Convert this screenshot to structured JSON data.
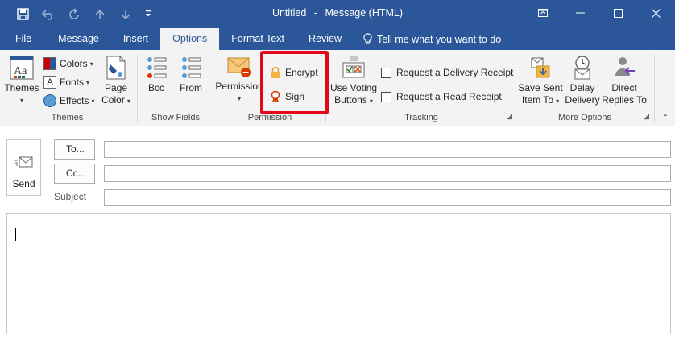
{
  "window": {
    "title_doc": "Untitled",
    "title_sep": "-",
    "title_type": "Message (HTML)",
    "titlebar_color": "#2b579a"
  },
  "quick_access": {
    "save_icon": "save-icon",
    "undo_icon": "undo-icon",
    "redo_icon": "redo-icon",
    "up_icon": "up-arrow-icon",
    "down_icon": "down-arrow-icon",
    "customize_icon": "customize-qat-icon"
  },
  "tabs": [
    {
      "label": "File"
    },
    {
      "label": "Message"
    },
    {
      "label": "Insert"
    },
    {
      "label": "Options",
      "active": true
    },
    {
      "label": "Format Text"
    },
    {
      "label": "Review"
    }
  ],
  "tellme": "Tell me what you want to do",
  "ribbon": {
    "themes_group": {
      "themes_label": "Themes",
      "colors_label": "Colors",
      "fonts_label": "Fonts",
      "effects_label": "Effects",
      "page_label_1": "Page",
      "page_label_2": "Color",
      "group_label": "Themes"
    },
    "show_fields": {
      "bcc_label": "Bcc",
      "from_label": "From",
      "group_label": "Show Fields"
    },
    "permission": {
      "permission_label": "Permission",
      "encrypt_label": "Encrypt",
      "sign_label": "Sign",
      "group_label": "Permission",
      "highlight_color": "#e3071a"
    },
    "tracking": {
      "voting_1": "Use Voting",
      "voting_2": "Buttons",
      "delivery_receipt": "Request a Delivery Receipt",
      "read_receipt": "Request a Read Receipt",
      "group_label": "Tracking"
    },
    "more_options": {
      "save_sent_1": "Save Sent",
      "save_sent_2": "Item To",
      "delay_1": "Delay",
      "delay_2": "Delivery",
      "direct_1": "Direct",
      "direct_2": "Replies To",
      "group_label": "More Options"
    }
  },
  "compose": {
    "send_label": "Send",
    "to_label": "To...",
    "cc_label": "Cc...",
    "subject_label": "Subject",
    "to_value": "",
    "cc_value": "",
    "subject_value": ""
  }
}
